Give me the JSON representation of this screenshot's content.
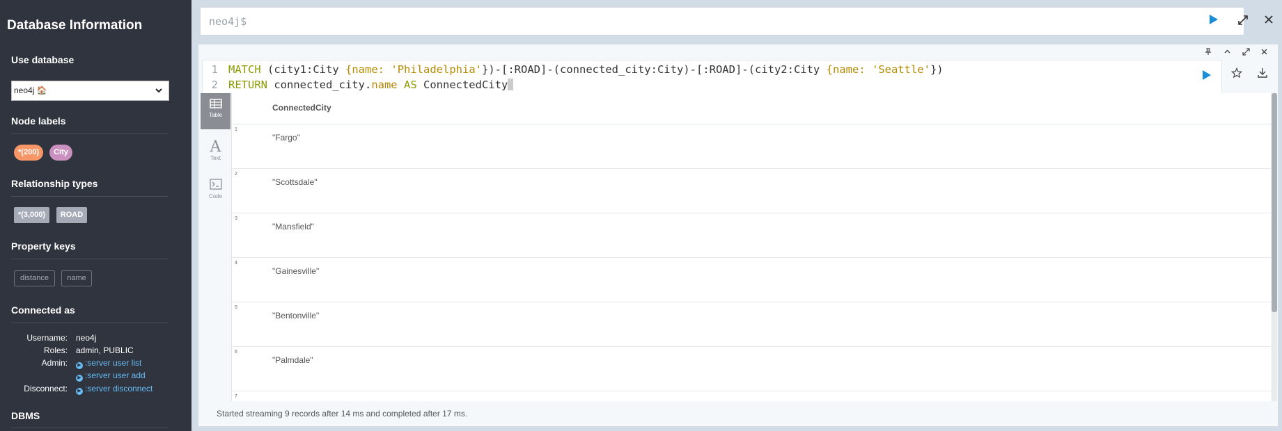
{
  "sidebar": {
    "title": "Database Information",
    "use_database": "Use database",
    "database_value": "neo4j 🏠",
    "node_labels_heading": "Node labels",
    "node_labels": [
      "*(200)",
      "City"
    ],
    "relationship_heading": "Relationship types",
    "relationship_types": [
      "*(3,000)",
      "ROAD"
    ],
    "property_heading": "Property keys",
    "property_keys": [
      "distance",
      "name"
    ],
    "connected_heading": "Connected as",
    "username_label": "Username:",
    "username": "neo4j",
    "roles_label": "Roles:",
    "roles": "admin, PUBLIC",
    "admin_label": "Admin:",
    "admin_link1": ":server user list",
    "admin_link2": ":server user add",
    "disconnect_label": "Disconnect:",
    "disconnect_link": ":server disconnect",
    "dbms_heading": "DBMS",
    "colors": {
      "bg": "#2f343e",
      "city": "#c990c0",
      "all_nodes": "#f79767",
      "rel": "#a5abb6",
      "link": "#68bdf6"
    }
  },
  "editor": {
    "prompt": "neo4j$"
  },
  "query": {
    "line_numbers": [
      "1",
      "2"
    ],
    "line1": {
      "t1": "MATCH",
      "t2": " (city1:City ",
      "t3": "{",
      "t4": "name:",
      "t5": " ",
      "t6": "'Philadelphia'",
      "t7": "})-[:ROAD]-(connected_city:City)-[:ROAD]-(city2:City ",
      "t8": "{",
      "t9": "name:",
      "t10": " ",
      "t11": "'Seattle'",
      "t12": "})"
    },
    "line2": {
      "t1": "RETURN",
      "t2": " connected_city.",
      "t3": "name",
      "t4": " ",
      "t5": "AS",
      "t6": " ConnectedCity"
    }
  },
  "views": {
    "table": "Table",
    "text": "Text",
    "code": "Code"
  },
  "results": {
    "column": "ConnectedCity",
    "rows": [
      {
        "index": "1",
        "value": "\"Fargo\""
      },
      {
        "index": "2",
        "value": "\"Scottsdale\""
      },
      {
        "index": "3",
        "value": "\"Mansfield\""
      },
      {
        "index": "4",
        "value": "\"Gainesville\""
      },
      {
        "index": "5",
        "value": "\"Bentonville\""
      },
      {
        "index": "6",
        "value": "\"Palmdale\""
      },
      {
        "index": "7",
        "value": ""
      }
    ]
  },
  "status": "Started streaming 9 records after 14 ms and completed after 17 ms."
}
